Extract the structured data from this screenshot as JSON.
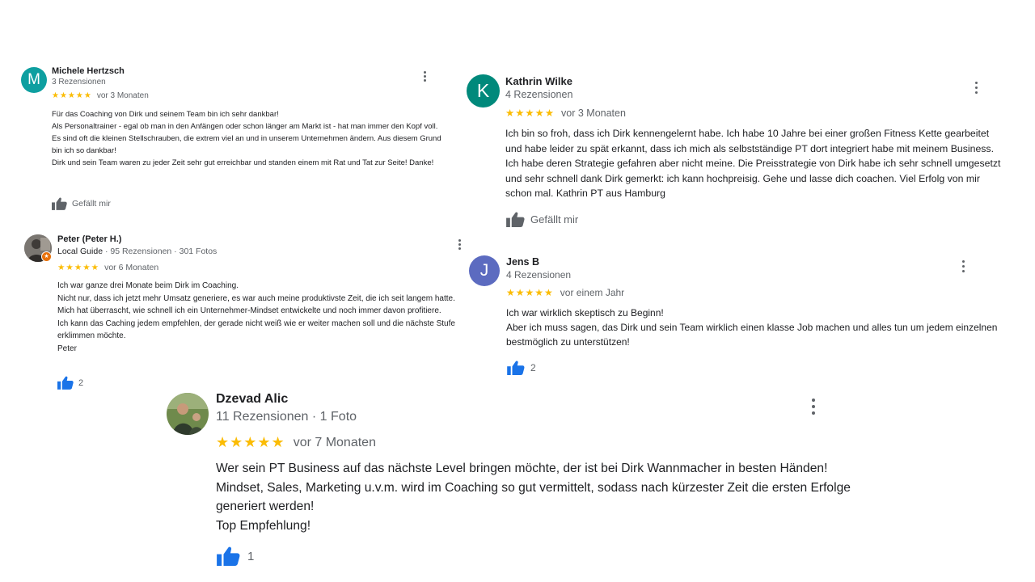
{
  "reviews": [
    {
      "name": "Michele Hertzsch",
      "initial": "M",
      "avatar_color": "#0e9fa0",
      "meta": "3 Rezensionen",
      "stars": "★★★★★",
      "when": "vor 3 Monaten",
      "text": "Für das Coaching von Dirk und seinem Team bin ich sehr dankbar!\nAls Personaltrainer - egal ob man in den Anfängen oder schon länger am Markt ist - hat man immer den Kopf voll.\nEs sind oft die kleinen Stellschrauben, die extrem viel an und in unserem Unternehmen ändern. Aus diesem Grund bin ich so dankbar!\nDirk und sein Team waren zu jeder Zeit sehr gut erreichbar und standen einem mit Rat und Tat zur Seite! Danke!",
      "like_label": "Gefällt mir",
      "like_count": ""
    },
    {
      "name": "Kathrin Wilke",
      "initial": "K",
      "avatar_color": "#00897b",
      "meta": "4 Rezensionen",
      "stars": "★★★★★",
      "when": "vor 3 Monaten",
      "text": "Ich bin so froh, dass ich Dirk kennengelernt habe. Ich habe 10 Jahre bei einer großen Fitness Kette gearbeitet und habe leider zu spät erkannt, dass ich mich als selbstständige PT dort integriert habe mit meinem Business. Ich habe deren Strategie gefahren aber nicht meine. Die Preisstrategie von Dirk habe ich sehr schnell umgesetzt und sehr schnell dank Dirk gemerkt: ich kann hochpreisig. Gehe und lasse dich coachen. Viel Erfolg von mir schon mal. Kathrin PT aus Hamburg",
      "like_label": "Gefällt mir",
      "like_count": ""
    },
    {
      "name": "Peter (Peter H.)",
      "meta_guide": "Local Guide",
      "meta": " · 95 Rezensionen · 301 Fotos",
      "stars": "★★★★★",
      "when": "vor 6 Monaten",
      "text": "Ich war ganze drei Monate beim Dirk im Coaching.\nNicht nur, dass ich jetzt mehr Umsatz generiere, es war auch meine produktivste Zeit, die ich seit langem hatte. Mich hat überrascht, wie schnell ich ein Unternehmer-Mindset entwickelte und noch immer davon profitiere.\nIch kann das Caching jedem empfehlen, der gerade nicht weiß wie er weiter machen soll und die nächste Stufe erklimmen möchte.\nPeter",
      "like_label": "",
      "like_count": "2"
    },
    {
      "name": "Jens B",
      "initial": "J",
      "avatar_color": "#5c6bc0",
      "meta": "4 Rezensionen",
      "stars": "★★★★★",
      "when": "vor einem Jahr",
      "text": "Ich war wirklich skeptisch zu Beginn!\nAber ich muss sagen, das Dirk und sein Team wirklich einen klasse Job machen und alles tun um jedem einzelnen bestmöglich zu unterstützen!",
      "like_label": "",
      "like_count": "2"
    },
    {
      "name": "Dzevad Alic",
      "meta": "11 Rezensionen · 1 Foto",
      "stars": "★★★★★",
      "when": "vor 7 Monaten",
      "text": "Wer sein PT Business auf das nächste Level bringen möchte, der ist bei Dirk Wannmacher in besten Händen! Mindset, Sales, Marketing u.v.m. wird im Coaching so gut vermittelt, sodass nach kürzester Zeit die ersten Erfolge generiert werden!\nTop Empfehlung!",
      "like_label": "",
      "like_count": "1"
    }
  ],
  "colors": {
    "star": "#fbbc04",
    "like_active": "#1a73e8",
    "like_inactive": "#5f6368"
  },
  "icons": {
    "menu": "more-vert-icon",
    "like": "thumb-up-icon",
    "local_guide": "local-guide-badge-icon"
  }
}
